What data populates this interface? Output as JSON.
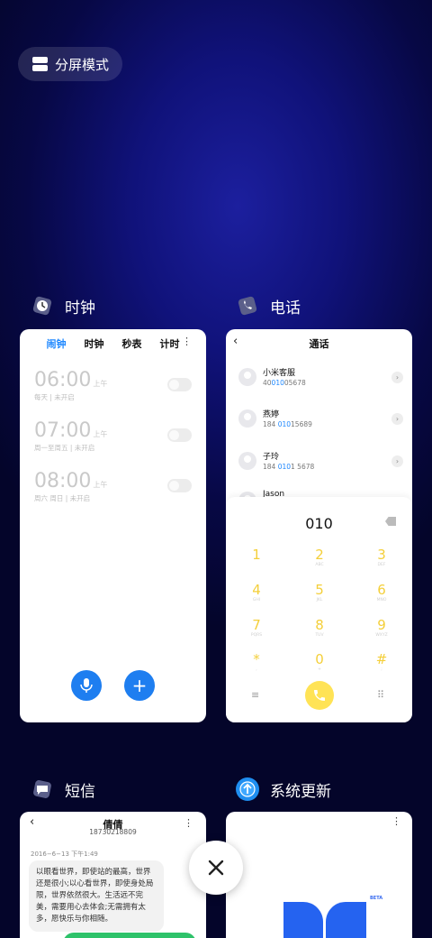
{
  "split_screen": {
    "label": "分屏模式"
  },
  "apps": [
    {
      "name": "时钟",
      "tabs": [
        "闹钟",
        "时钟",
        "秒表",
        "计时"
      ],
      "alarms": [
        {
          "time": "06:00",
          "ampm": "上午",
          "desc": "每天 | 未开启"
        },
        {
          "time": "07:00",
          "ampm": "上午",
          "desc": "周一至周五 | 未开启"
        },
        {
          "time": "08:00",
          "ampm": "上午",
          "desc": "周六 周日 | 未开启"
        }
      ]
    },
    {
      "name": "电话",
      "title": "通话",
      "contacts": [
        {
          "name": "小米客服",
          "num_pre": "40",
          "num_hi": "010",
          "num_post": "05678"
        },
        {
          "name": "燕婷",
          "num_pre": "184 ",
          "num_hi": "010",
          "num_post": "15689"
        },
        {
          "name": "子玲",
          "num_pre": "184 ",
          "num_hi": "010",
          "num_post": "1 5678"
        },
        {
          "name": "Jason",
          "num_pre": "",
          "num_hi": "",
          "num_post": ""
        }
      ],
      "dialed": "010",
      "keys": [
        {
          "d": "1",
          "l": ""
        },
        {
          "d": "2",
          "l": "ABC"
        },
        {
          "d": "3",
          "l": "DEF"
        },
        {
          "d": "4",
          "l": "GHI"
        },
        {
          "d": "5",
          "l": "JKL"
        },
        {
          "d": "6",
          "l": "MNO"
        },
        {
          "d": "7",
          "l": "PQRS"
        },
        {
          "d": "8",
          "l": "TUV"
        },
        {
          "d": "9",
          "l": "WXYZ"
        },
        {
          "d": "*",
          "l": ","
        },
        {
          "d": "0",
          "l": "+"
        },
        {
          "d": "#",
          "l": ";"
        }
      ]
    },
    {
      "name": "短信",
      "contact_name": "倩倩",
      "contact_number": "18730218809",
      "timestamp": "2016−6−13 下午1:49",
      "message": "以眼看世界，即使站的最高，世界还是很小;以心看世界，即使身处局限，世界依然很大。生活远不完美，需要用心去体会;无需拥有太多，愿快乐与你相随。"
    },
    {
      "name": "系统更新",
      "badge": "BETA"
    }
  ],
  "colors": {
    "accent": "#1e88ff",
    "dial_yellow": "#f4cf3a",
    "call_yellow": "#ffe356",
    "fab_blue": "#1e7ef0"
  }
}
